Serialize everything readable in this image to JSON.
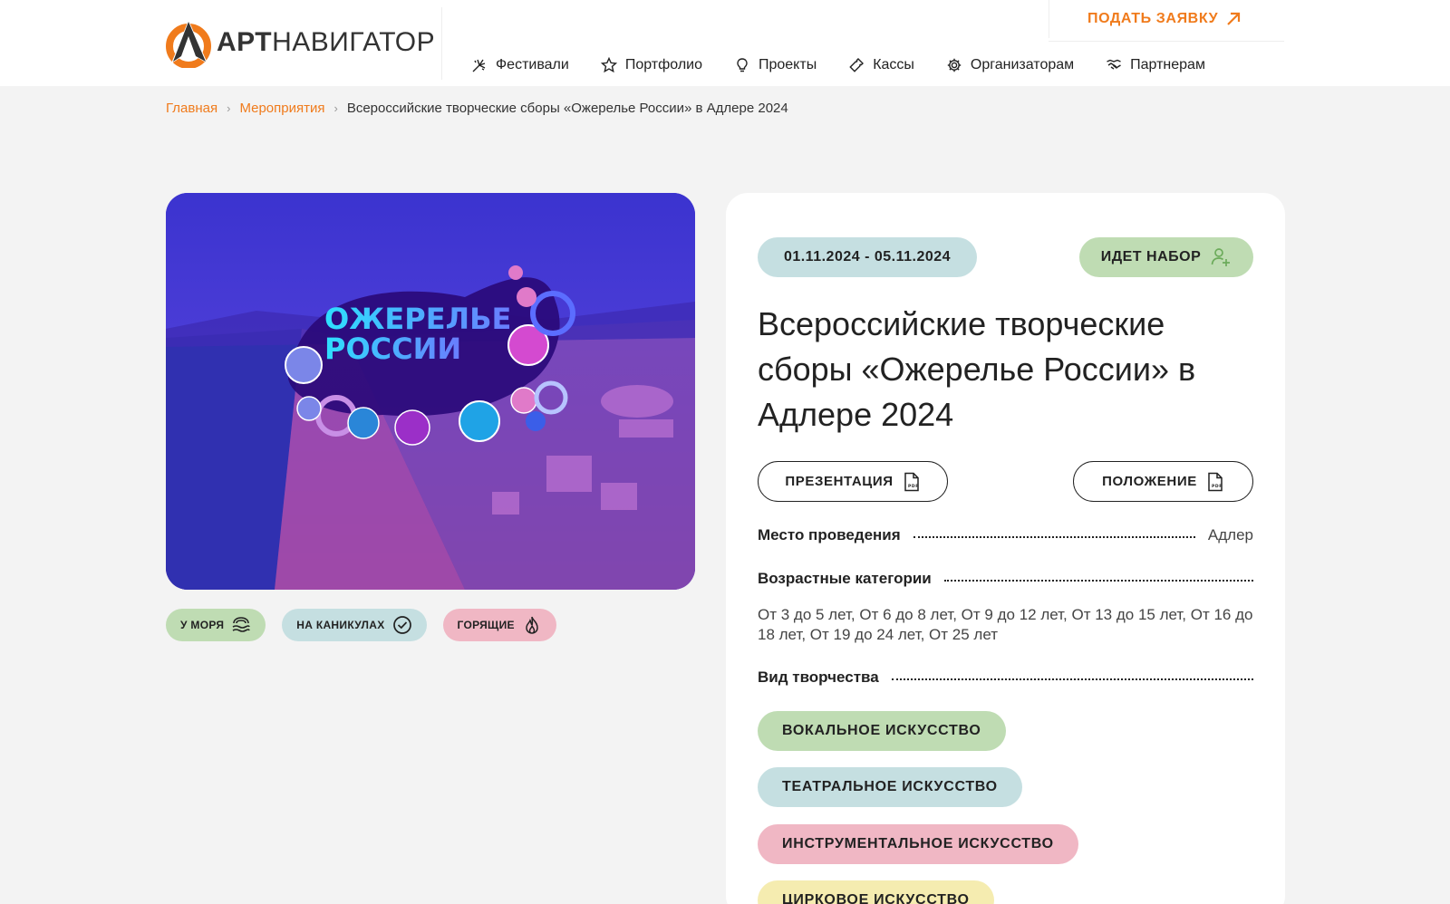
{
  "header": {
    "logo_bold": "АРТ",
    "logo_regular": "НАВИГАТОР",
    "cta_label": "ПОДАТЬ ЗАЯВКУ",
    "nav": [
      {
        "label": "Фестивали",
        "icon": "fireworks-icon"
      },
      {
        "label": "Портфолио",
        "icon": "star-icon"
      },
      {
        "label": "Проекты",
        "icon": "lightbulb-icon"
      },
      {
        "label": "Кассы",
        "icon": "ticket-icon"
      },
      {
        "label": "Организаторам",
        "icon": "gear-icon"
      },
      {
        "label": "Партнерам",
        "icon": "handshake-icon"
      }
    ]
  },
  "breadcrumb": {
    "items": [
      "Главная",
      "Мероприятия"
    ],
    "current": "Всероссийские творческие сборы «Ожерелье России» в Адлере 2024"
  },
  "hero": {
    "image_text_line1": "ОЖЕРЕЛЬЕ",
    "image_text_line2": "РОССИИ"
  },
  "tags": [
    {
      "label": "У МОРЯ",
      "icon": "waves-icon",
      "color": "#bfdcb3"
    },
    {
      "label": "НА КАНИКУЛАХ",
      "icon": "check-circle-icon",
      "color": "#c5dfe1"
    },
    {
      "label": "ГОРЯЩИЕ",
      "icon": "flame-icon",
      "color": "#f0b7c4"
    }
  ],
  "event": {
    "dates": "01.11.2024 - 05.11.2024",
    "status": "ИДЕТ НАБОР",
    "title": "Всероссийские творческие сборы «Ожерелье России» в Адлере 2024",
    "presentation_label": "ПРЕЗЕНТАЦИЯ",
    "regulation_label": "ПОЛОЖЕНИЕ",
    "place_label": "Место проведения",
    "place_value": "Адлер",
    "ages_label": "Возрастные категории",
    "ages_value": "От 3 до 5 лет, От 6 до 8 лет, От 9 до 12 лет, От 13 до 15 лет, От 16 до 18 лет, От 19 до 24 лет, От 25 лет",
    "kind_label": "Вид творчества",
    "genres": [
      "ВОКАЛЬНОЕ ИСКУССТВО",
      "ТЕАТРАЛЬНОЕ ИСКУССТВО",
      "ИНСТРУМЕНТАЛЬНОЕ ИСКУССТВО",
      "ЦИРКОВОЕ ИСКУССТВО"
    ]
  },
  "colors": {
    "accent": "#f07b1c",
    "green": "#bfdcb3",
    "blue": "#c5dfe1",
    "pink": "#f0b7c4",
    "yellow": "#f5ecb0"
  }
}
